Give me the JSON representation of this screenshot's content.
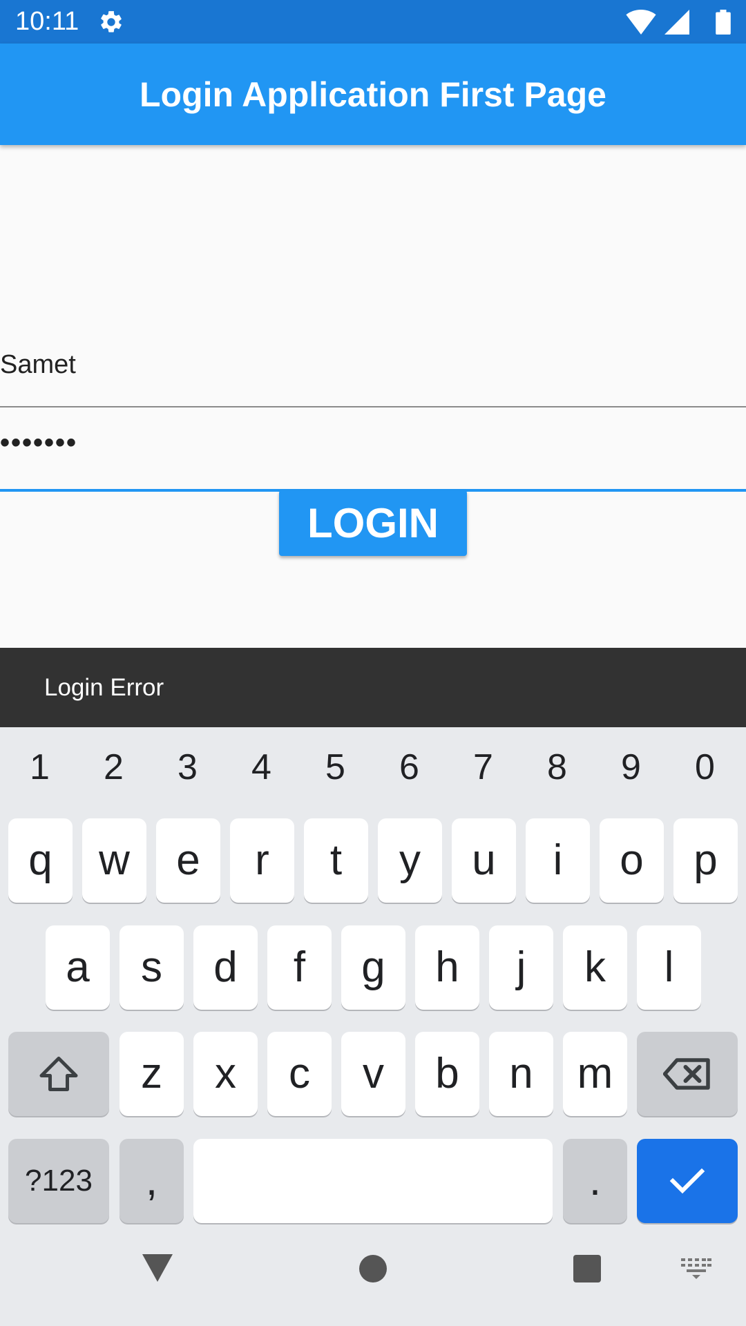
{
  "status_bar": {
    "time": "10:11",
    "icons": [
      "settings-icon",
      "wifi-icon",
      "signal-icon",
      "battery-icon"
    ],
    "background": "#1976d2"
  },
  "app_bar": {
    "title": "Login Application First Page",
    "background": "#2196f3"
  },
  "form": {
    "username_value": "Samet",
    "password_value": "•••••••",
    "login_label": "LOGIN"
  },
  "snackbar": {
    "message": "Login Error"
  },
  "keyboard": {
    "numbers": [
      "1",
      "2",
      "3",
      "4",
      "5",
      "6",
      "7",
      "8",
      "9",
      "0"
    ],
    "row1": [
      "q",
      "w",
      "e",
      "r",
      "t",
      "y",
      "u",
      "i",
      "o",
      "p"
    ],
    "row2": [
      "a",
      "s",
      "d",
      "f",
      "g",
      "h",
      "j",
      "k",
      "l"
    ],
    "row3": [
      "z",
      "x",
      "c",
      "v",
      "b",
      "n",
      "m"
    ],
    "symbols_label": "?123",
    "comma_label": ",",
    "period_label": ".",
    "accent": "#1a73e8"
  },
  "nav_bar": {
    "icons": [
      "back-icon",
      "home-icon",
      "recents-icon",
      "keyboard-switch-icon"
    ]
  }
}
